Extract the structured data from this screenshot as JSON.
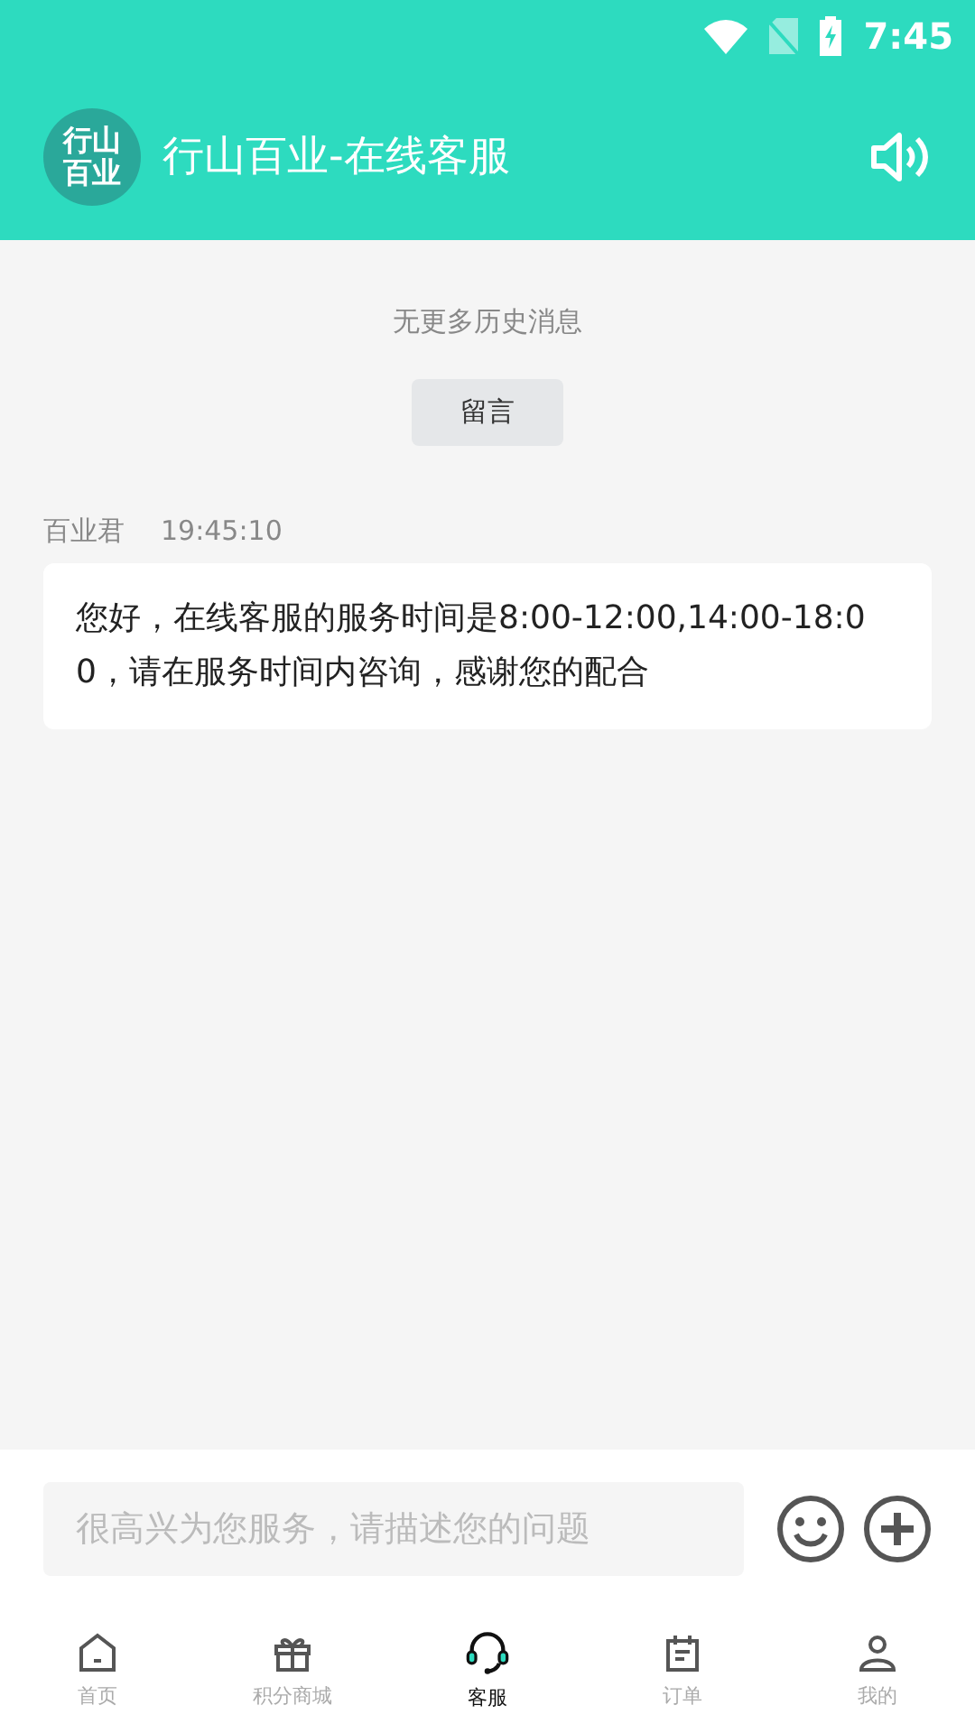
{
  "status_bar": {
    "time": "7:45"
  },
  "header": {
    "logo_lines": [
      "行山",
      "百业"
    ],
    "title": "行山百业-在线客服"
  },
  "chat": {
    "history_note": "无更多历史消息",
    "leave_message_button": "留言",
    "messages": [
      {
        "sender": "百业君",
        "time": "19:45:10",
        "text": "您好，在线客服的服务时间是8:00-12:00,14:00-18:00，请在服务时间内咨询，感谢您的配合"
      }
    ]
  },
  "composer": {
    "placeholder": "很高兴为您服务，请描述您的问题"
  },
  "tabs": [
    {
      "kind": "home",
      "label": "首页",
      "selected": false
    },
    {
      "kind": "gift",
      "label": "积分商城",
      "selected": false
    },
    {
      "kind": "headset",
      "label": "客服",
      "selected": true
    },
    {
      "kind": "order",
      "label": "订单",
      "selected": false
    },
    {
      "kind": "person",
      "label": "我的",
      "selected": false
    }
  ]
}
